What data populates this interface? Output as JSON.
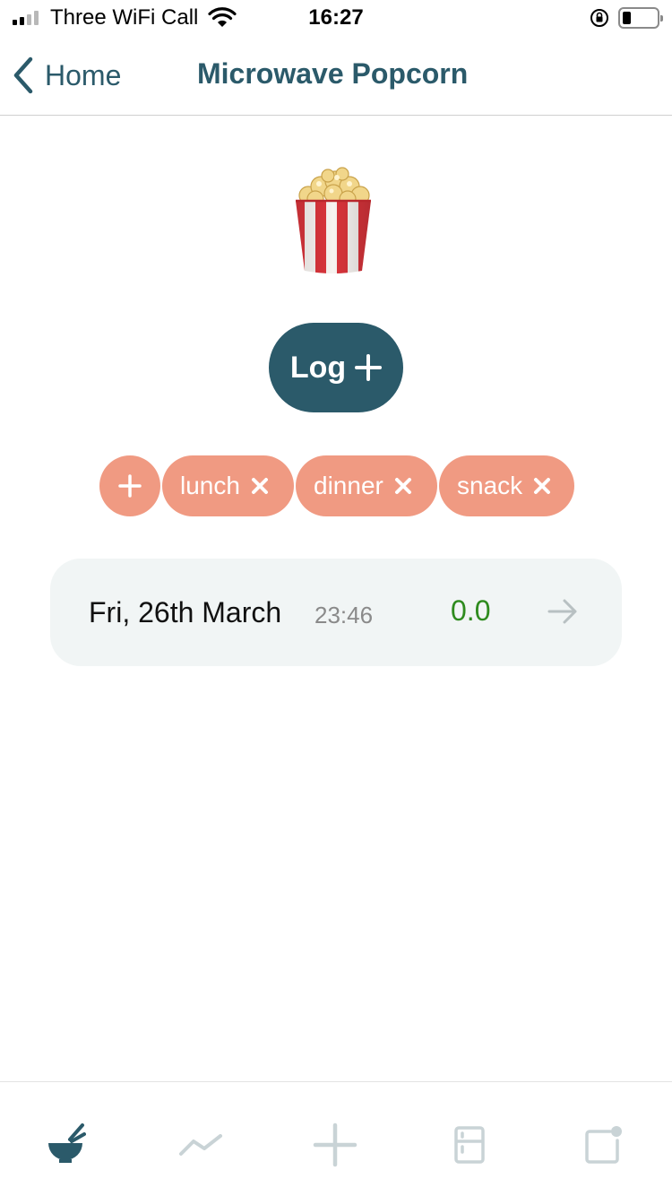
{
  "status_bar": {
    "carrier": "Three WiFi Call",
    "time": "16:27"
  },
  "nav": {
    "back_label": "Home",
    "title": "Microwave Popcorn"
  },
  "food_icon": "popcorn-icon",
  "log_button": {
    "label": "Log",
    "icon": "plus-icon"
  },
  "tags": [
    {
      "label": "lunch"
    },
    {
      "label": "dinner"
    },
    {
      "label": "snack"
    }
  ],
  "entries": [
    {
      "date": "Fri, 26th March",
      "time": "23:46",
      "value": "0.0"
    }
  ],
  "colors": {
    "primary": "#2b5a6a",
    "tag": "#f09a82",
    "value_green": "#2e8b1e",
    "card_bg": "#f1f5f5",
    "inactive_icon": "#c9d3d6"
  },
  "tab_bar": [
    {
      "icon": "bowl-icon",
      "active": true
    },
    {
      "icon": "trend-icon",
      "active": false
    },
    {
      "icon": "plus-icon",
      "active": false
    },
    {
      "icon": "fridge-icon",
      "active": false
    },
    {
      "icon": "notification-icon",
      "active": false
    }
  ]
}
